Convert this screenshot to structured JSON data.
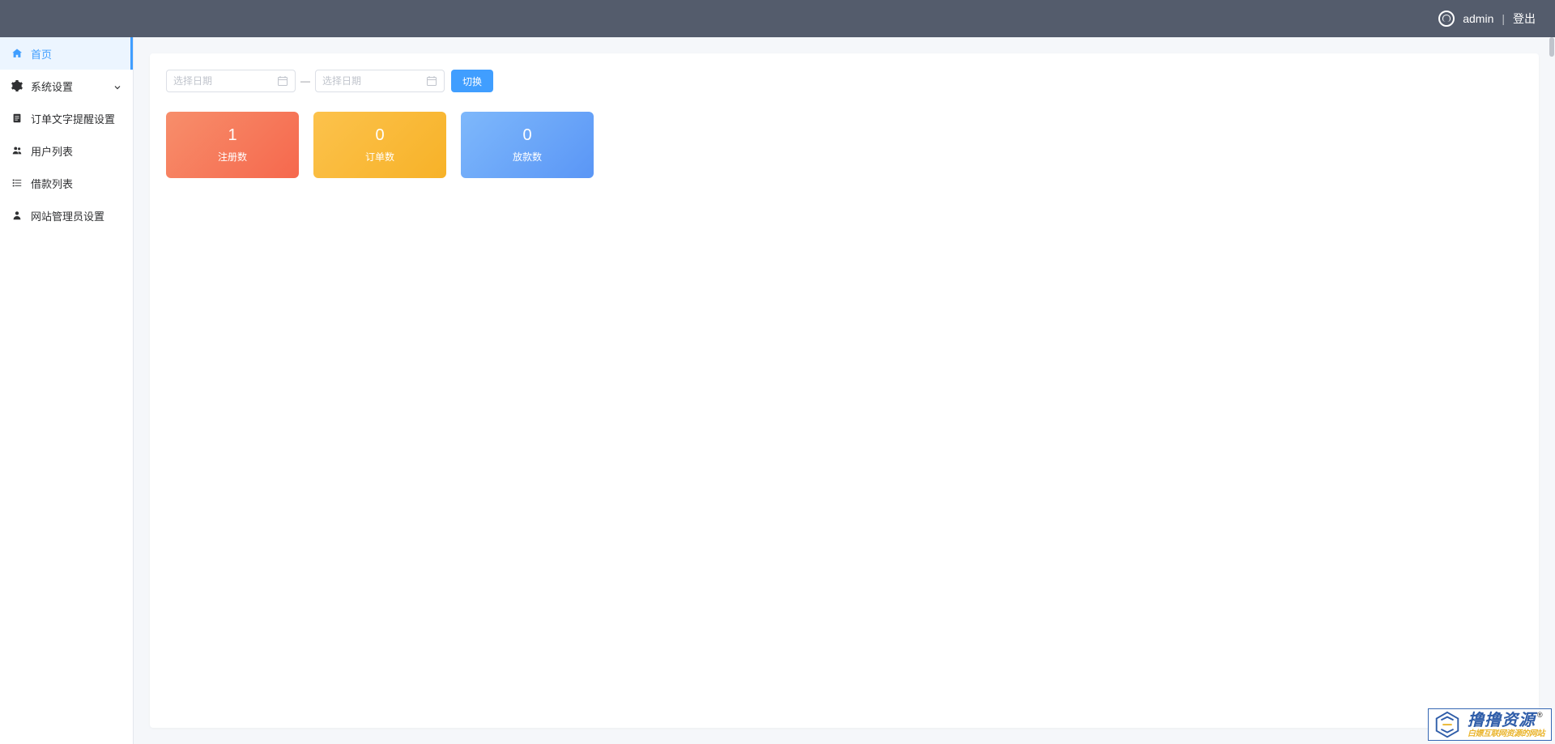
{
  "header": {
    "username": "admin",
    "divider": "|",
    "logout": "登出"
  },
  "sidebar": {
    "items": [
      {
        "icon": "home",
        "label": "首页",
        "active": true,
        "expandable": false
      },
      {
        "icon": "gear",
        "label": "系统设置",
        "active": false,
        "expandable": true
      },
      {
        "icon": "doc",
        "label": "订单文字提醒设置",
        "active": false,
        "expandable": false
      },
      {
        "icon": "users",
        "label": "用户列表",
        "active": false,
        "expandable": false
      },
      {
        "icon": "list",
        "label": "借款列表",
        "active": false,
        "expandable": false
      },
      {
        "icon": "person",
        "label": "网站管理员设置",
        "active": false,
        "expandable": false
      }
    ]
  },
  "filter": {
    "date_start_placeholder": "选择日期",
    "date_end_placeholder": "选择日期",
    "range_separator": "—",
    "submit_label": "切换"
  },
  "stats": [
    {
      "value": "1",
      "label": "注册数",
      "theme": "orange"
    },
    {
      "value": "0",
      "label": "订单数",
      "theme": "yellow"
    },
    {
      "value": "0",
      "label": "放款数",
      "theme": "blue"
    }
  ],
  "watermark": {
    "title": "撸撸资源",
    "registered": "®",
    "subtitle": "白嫖互联网资源的网站"
  }
}
